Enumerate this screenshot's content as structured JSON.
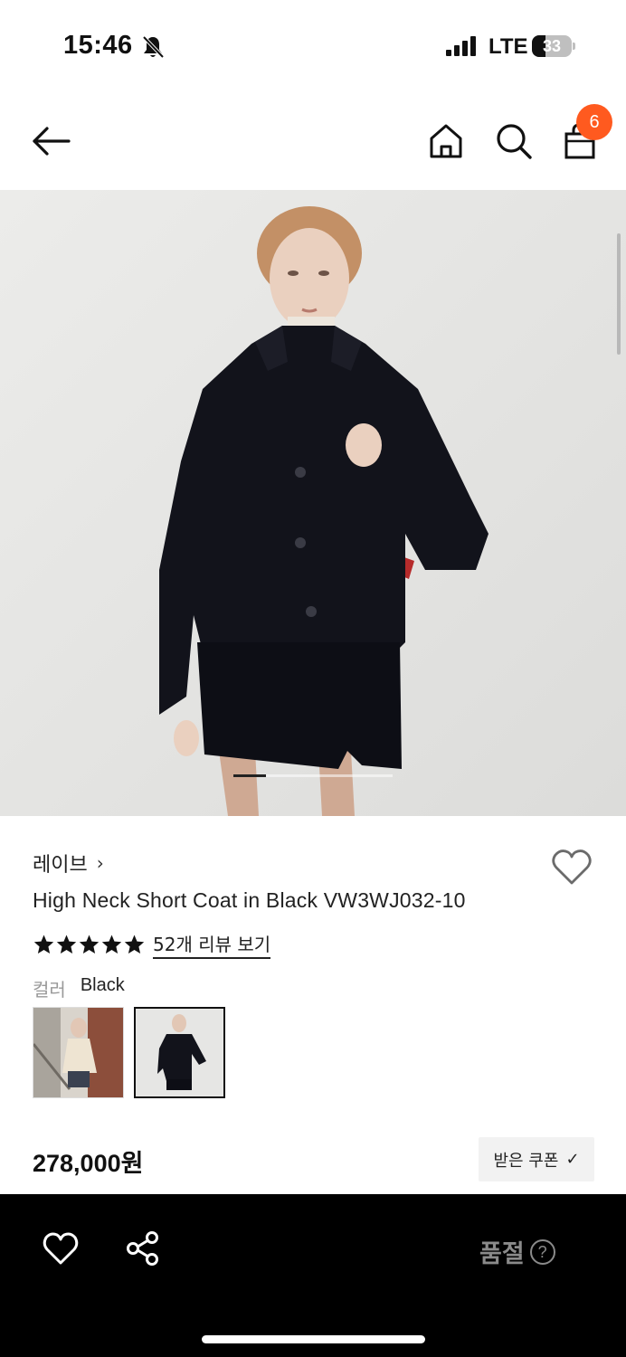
{
  "status_bar": {
    "time": "15:46",
    "network": "LTE",
    "battery_level": "33",
    "battery_percent": 33,
    "icons": [
      "bell-slash-icon",
      "signal-icon",
      "battery-icon"
    ]
  },
  "header": {
    "icons": [
      "back-arrow-icon",
      "home-icon",
      "search-icon",
      "shopping-bag-icon"
    ],
    "cart_count": "6",
    "badge_color": "#ff5a1f"
  },
  "gallery": {
    "image_count": 5,
    "current_index": 1
  },
  "product": {
    "brand": "레이브",
    "brand_chevron": "›",
    "name": "High Neck Short Coat in Black VW3WJ032-10",
    "rating_stars": 5,
    "review_link": "52개 리뷰 보기",
    "color_label": "컬러",
    "color_value": "Black",
    "color_swatches": [
      "cream-coat-swatch",
      "black-coat-swatch"
    ],
    "selected_swatch": 2,
    "price": "278,000원",
    "coupon_label": "받은 쿠폰",
    "coupon_check": "✓"
  },
  "bottom_bar": {
    "icons": [
      "heart-icon",
      "share-icon"
    ],
    "status_label": "품절",
    "help_symbol": "?",
    "status_color": "#8a8a8a"
  }
}
